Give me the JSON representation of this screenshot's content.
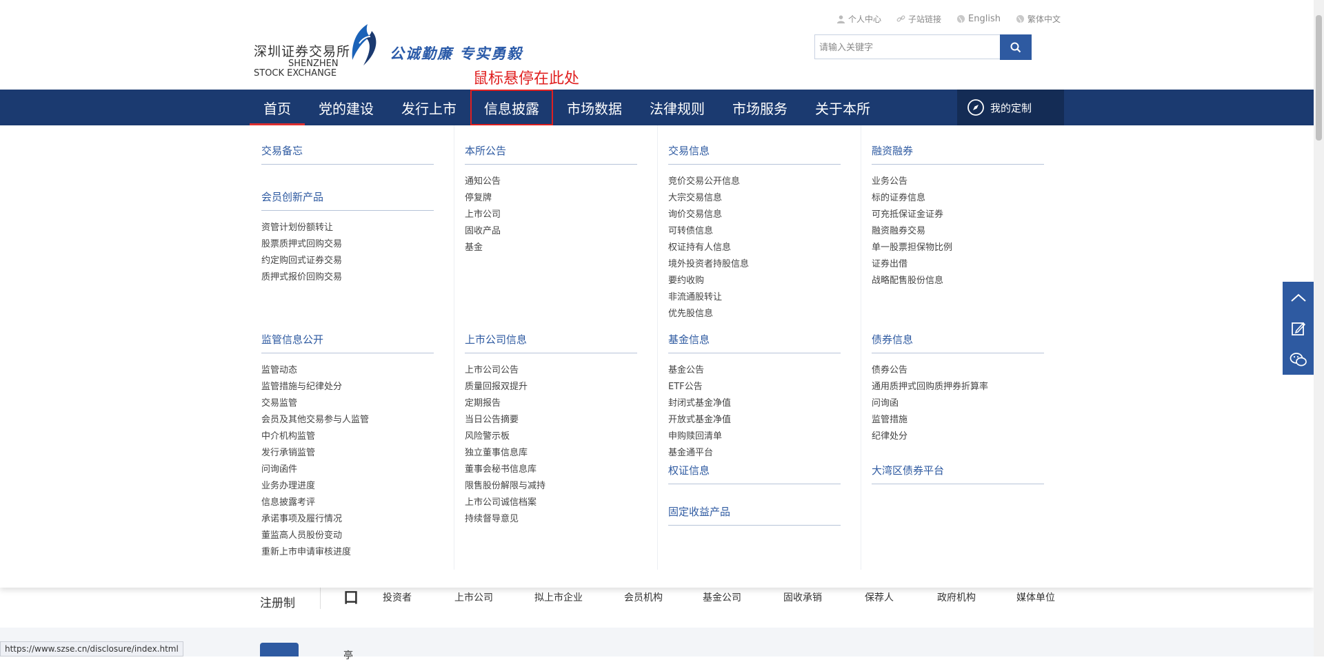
{
  "header": {
    "logo_cn": "深圳证券交易所",
    "logo_en_line1": "SHENZHEN",
    "logo_en_line2": "STOCK EXCHANGE",
    "slogan": "公诚勤廉 专实勇毅",
    "annotation": "鼠标悬停在此处",
    "top_links": [
      "个人中心",
      "子站链接",
      "English",
      "繁体中文"
    ],
    "search_placeholder": "请输入关键字"
  },
  "nav": {
    "items": [
      "首页",
      "党的建设",
      "发行上市",
      "信息披露",
      "市场数据",
      "法律规则",
      "市场服务",
      "关于本所"
    ],
    "active_index": 0,
    "hover_index": 3,
    "custom_label": "我的定制"
  },
  "menu": {
    "columns": [
      [
        {
          "title": "交易备忘",
          "items": []
        },
        {
          "title": "会员创新产品",
          "items": [
            "资管计划份额转让",
            "股票质押式回购交易",
            "约定购回式证券交易",
            "质押式报价回购交易"
          ]
        },
        {
          "title": "监管信息公开",
          "items": [
            "监管动态",
            "监管措施与纪律处分",
            "交易监管",
            "会员及其他交易参与人监管",
            "中介机构监管",
            "发行承销监管",
            "问询函件",
            "业务办理进度",
            "信息披露考评",
            "承诺事项及履行情况",
            "董监高人员股份变动",
            "重新上市申请审核进度"
          ]
        }
      ],
      [
        {
          "title": "本所公告",
          "items": [
            "通知公告",
            "停复牌",
            "上市公司",
            "固收产品",
            "基金"
          ]
        },
        {
          "title": "上市公司信息",
          "items": [
            "上市公司公告",
            "质量回报双提升",
            "定期报告",
            "当日公告摘要",
            "风险警示板",
            "独立董事信息库",
            "董事会秘书信息库",
            "限售股份解限与减持",
            "上市公司诚信档案",
            "持续督导意见"
          ]
        }
      ],
      [
        {
          "title": "交易信息",
          "items": [
            "竞价交易公开信息",
            "大宗交易信息",
            "询价交易信息",
            "可转债信息",
            "权证持有人信息",
            "境外投资者持股信息",
            "要约收购",
            "非流通股转让",
            "优先股信息"
          ]
        },
        {
          "title": "基金信息",
          "items": [
            "基金公告",
            "ETF公告",
            "封闭式基金净值",
            "开放式基金净值",
            "申购赎回清单",
            "基金通平台"
          ]
        },
        {
          "title": "权证信息",
          "items": []
        },
        {
          "title": "固定收益产品",
          "items": []
        }
      ],
      [
        {
          "title": "融资融券",
          "items": [
            "业务公告",
            "标的证券信息",
            "可充抵保证金证券",
            "融资融券交易",
            "单一股票担保物比例",
            "证券出借",
            "战略配售股份信息"
          ]
        },
        {
          "title": "债券信息",
          "items": [
            "债券公告",
            "通用质押式回购质押券折算率",
            "问询函",
            "监管措施",
            "纪律处分"
          ]
        },
        {
          "title": "大湾区债券平台",
          "items": []
        }
      ]
    ]
  },
  "background": {
    "section_label": "注册制",
    "section_char": "口",
    "categories": [
      "投资者",
      "上市公司",
      "拟上市企业",
      "会员机构",
      "基金公司",
      "固收承销",
      "保荐人",
      "政府机构",
      "媒体单位"
    ],
    "second_char": "亭"
  },
  "status_url": "https://www.szse.cn/disclosure/index.html",
  "colors": {
    "nav_bg": "#1b3a70",
    "accent_blue": "#2e5aa1",
    "annotation_red": "#e02020"
  }
}
